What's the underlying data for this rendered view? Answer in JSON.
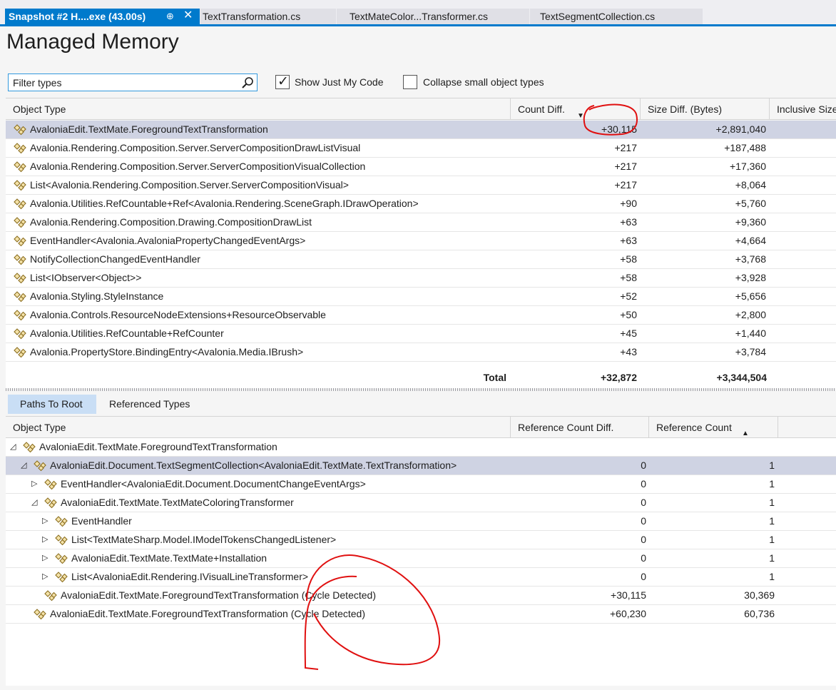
{
  "tabs": {
    "active": {
      "label": "Snapshot #2 H....exe (43.00s)",
      "pin": "⊕",
      "close": "✕"
    },
    "others": [
      "TextTransformation.cs",
      "TextMateColor...Transformer.cs",
      "TextSegmentCollection.cs"
    ]
  },
  "page_title": "Managed Memory",
  "toolbar": {
    "filter_placeholder": "Filter types",
    "show_just_my_code": {
      "label": "Show Just My Code",
      "checked": true
    },
    "collapse_small": {
      "label": "Collapse small object types",
      "checked": false
    }
  },
  "upper": {
    "columns": {
      "object_type": "Object Type",
      "count_diff": "Count Diff.",
      "size_diff": "Size Diff. (Bytes)",
      "inclusive_size": "Inclusive Size"
    },
    "rows": [
      {
        "name": "AvaloniaEdit.TextMate.ForegroundTextTransformation",
        "count": "+30,115",
        "size": "+2,891,040"
      },
      {
        "name": "Avalonia.Rendering.Composition.Server.ServerCompositionDrawListVisual",
        "count": "+217",
        "size": "+187,488"
      },
      {
        "name": "Avalonia.Rendering.Composition.Server.ServerCompositionVisualCollection",
        "count": "+217",
        "size": "+17,360"
      },
      {
        "name": "List<Avalonia.Rendering.Composition.Server.ServerCompositionVisual>",
        "count": "+217",
        "size": "+8,064"
      },
      {
        "name": "Avalonia.Utilities.RefCountable+Ref<Avalonia.Rendering.SceneGraph.IDrawOperation>",
        "count": "+90",
        "size": "+5,760"
      },
      {
        "name": "Avalonia.Rendering.Composition.Drawing.CompositionDrawList",
        "count": "+63",
        "size": "+9,360"
      },
      {
        "name": "EventHandler<Avalonia.AvaloniaPropertyChangedEventArgs>",
        "count": "+63",
        "size": "+4,664"
      },
      {
        "name": "NotifyCollectionChangedEventHandler",
        "count": "+58",
        "size": "+3,768"
      },
      {
        "name": "List<IObserver<Object>>",
        "count": "+58",
        "size": "+3,928"
      },
      {
        "name": "Avalonia.Styling.StyleInstance",
        "count": "+52",
        "size": "+5,656"
      },
      {
        "name": "Avalonia.Controls.ResourceNodeExtensions+ResourceObservable",
        "count": "+50",
        "size": "+2,800"
      },
      {
        "name": "Avalonia.Utilities.RefCountable+RefCounter",
        "count": "+45",
        "size": "+1,440"
      },
      {
        "name": "Avalonia.PropertyStore.BindingEntry<Avalonia.Media.IBrush>",
        "count": "+43",
        "size": "+3,784"
      }
    ],
    "total": {
      "label": "Total",
      "count": "+32,872",
      "size": "+3,344,504"
    }
  },
  "lower": {
    "tabs": [
      "Paths To Root",
      "Referenced Types"
    ],
    "columns": {
      "object_type": "Object Type",
      "ref_count_diff": "Reference Count Diff.",
      "ref_count": "Reference Count"
    },
    "rows": [
      {
        "expander": "◿",
        "name": "AvaloniaEdit.TextMate.ForegroundTextTransformation",
        "diff": "",
        "count": ""
      },
      {
        "expander": "◿",
        "name": "AvaloniaEdit.Document.TextSegmentCollection<AvaloniaEdit.TextMate.TextTransformation>",
        "diff": "0",
        "count": "1"
      },
      {
        "expander": "▷",
        "name": "EventHandler<AvaloniaEdit.Document.DocumentChangeEventArgs>",
        "diff": "0",
        "count": "1"
      },
      {
        "expander": "◿",
        "name": "AvaloniaEdit.TextMate.TextMateColoringTransformer",
        "diff": "0",
        "count": "1"
      },
      {
        "expander": "▷",
        "name": "EventHandler",
        "diff": "0",
        "count": "1"
      },
      {
        "expander": "▷",
        "name": "List<TextMateSharp.Model.IModelTokensChangedListener>",
        "diff": "0",
        "count": "1"
      },
      {
        "expander": "▷",
        "name": "AvaloniaEdit.TextMate.TextMate+Installation",
        "diff": "0",
        "count": "1"
      },
      {
        "expander": "▷",
        "name": "List<AvaloniaEdit.Rendering.IVisualLineTransformer>",
        "diff": "0",
        "count": "1"
      },
      {
        "expander": "",
        "name": "AvaloniaEdit.TextMate.ForegroundTextTransformation (Cycle Detected)",
        "diff": "+30,115",
        "count": "30,369"
      },
      {
        "expander": "",
        "name": "AvaloniaEdit.TextMate.ForegroundTextTransformation (Cycle Detected)",
        "diff": "+60,230",
        "count": "60,736"
      }
    ]
  },
  "colors": {
    "accent": "#007acc",
    "selection": "#cfd3e3",
    "annotation": "#e01010"
  },
  "icons": [
    "search-icon",
    "class-icon",
    "pin-icon",
    "close-icon",
    "sort-descending-icon",
    "sort-ascending-icon"
  ]
}
